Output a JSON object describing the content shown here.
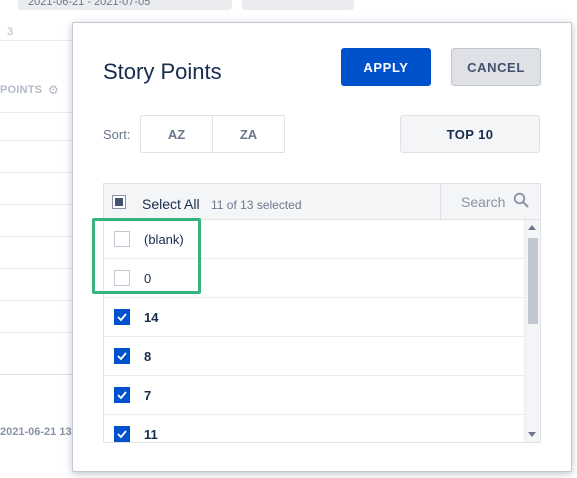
{
  "background": {
    "date_filter_text": "2021-06-21 - 2021-07-05",
    "column_number": "3",
    "column_title": "POINTS",
    "row_date": "2021-06-21 13"
  },
  "popup": {
    "title": "Story Points",
    "apply_label": "APPLY",
    "cancel_label": "CANCEL",
    "sort_label": "Sort:",
    "sort_az_label": "AZ",
    "sort_za_label": "ZA",
    "top10_label": "TOP 10",
    "select_all_label": "Select All",
    "selected_count": "11 of 13 selected",
    "search_placeholder": "Search",
    "items": [
      {
        "label": "(blank)",
        "checked": false
      },
      {
        "label": "0",
        "checked": false
      },
      {
        "label": "14",
        "checked": true
      },
      {
        "label": "8",
        "checked": true
      },
      {
        "label": "7",
        "checked": true
      },
      {
        "label": "11",
        "checked": true
      }
    ]
  },
  "colors": {
    "accent": "#0052cc",
    "highlight": "#36b37e"
  },
  "icons": [
    "search-icon",
    "gear-icon",
    "checkmark-icon",
    "scroll-up-arrow",
    "scroll-down-arrow"
  ]
}
